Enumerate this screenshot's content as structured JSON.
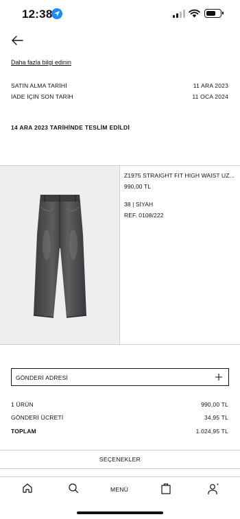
{
  "status_bar": {
    "time": "12:38",
    "battery_level": 0.7
  },
  "icons": {
    "back": "arrow-left-icon",
    "location": "location-arrow-icon",
    "plus": "plus-icon",
    "home": "home-icon",
    "search": "search-icon",
    "bag": "shopping-bag-icon",
    "user": "user-icon"
  },
  "header": {
    "info_link": "Daha fazla bilgi edinin"
  },
  "order": {
    "purchase_label": "SATIN ALMA TARİHİ",
    "purchase_date": "11 ARA 2023",
    "return_label": "İADE İÇİN SON TARİH",
    "return_date": "11 OCA 2024",
    "delivery_status": "14 ARA 2023 TARİHİNDE TESLİM EDİLDİ"
  },
  "product": {
    "name": "Z1975 STRAIGHT FIT HIGH WAIST UZ...",
    "price": "990,00 TL",
    "size_color": "38 | SİYAH",
    "ref": "REF. 0108/222"
  },
  "shipping": {
    "address_label": "GÖNDERİ ADRESİ"
  },
  "summary": {
    "items_label": "1 ÜRÜN",
    "items_value": "990,00 TL",
    "shipping_label": "GÖNDERİ ÜCRETİ",
    "shipping_value": "34,95 TL",
    "total_label": "TOPLAM",
    "total_value": "1.024,95 TL"
  },
  "options": {
    "label": "SEÇENEKLER"
  },
  "nav": {
    "menu_label": "MENÜ"
  }
}
